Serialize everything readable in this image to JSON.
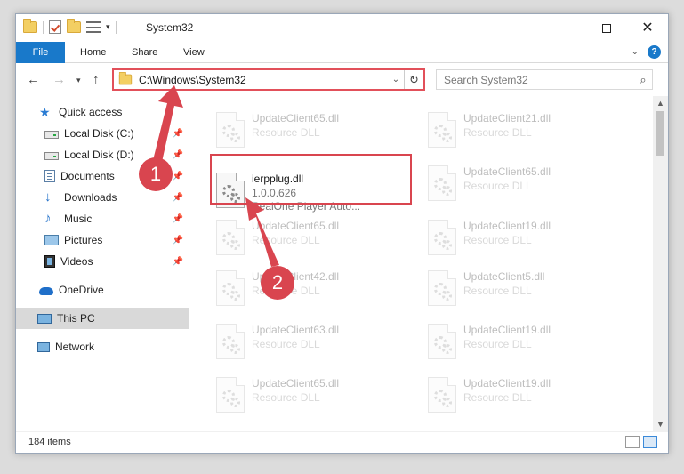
{
  "window": {
    "title": "System32",
    "controls": {
      "minimize": "minimize",
      "maximize": "maximize",
      "close": "✕"
    }
  },
  "ribbon": {
    "tabs": [
      {
        "label": "File"
      },
      {
        "label": "Home"
      },
      {
        "label": "Share"
      },
      {
        "label": "View"
      }
    ],
    "help": "?"
  },
  "address": {
    "path": "C:\\Windows\\System32",
    "refresh": "↻"
  },
  "search": {
    "placeholder": "Search System32",
    "icon": "search-icon"
  },
  "sidebar": {
    "items": [
      {
        "label": "Quick access",
        "icon": "star-icon"
      },
      {
        "label": "Local Disk (C:)",
        "icon": "disk-icon"
      },
      {
        "label": "Local Disk (D:)",
        "icon": "disk-icon"
      },
      {
        "label": "Documents",
        "icon": "documents-icon"
      },
      {
        "label": "Downloads",
        "icon": "downloads-icon"
      },
      {
        "label": "Music",
        "icon": "music-icon"
      },
      {
        "label": "Pictures",
        "icon": "pictures-icon"
      },
      {
        "label": "Videos",
        "icon": "videos-icon"
      },
      {
        "label": "OneDrive",
        "icon": "onedrive-icon"
      },
      {
        "label": "This PC",
        "icon": "this-pc-icon"
      },
      {
        "label": "Network",
        "icon": "network-icon"
      }
    ]
  },
  "files": {
    "left": [
      {
        "name": "UpdateClient65.dll",
        "type": "Resource DLL"
      },
      {
        "name": "ierpplug.dll",
        "version": "1.0.0.626",
        "description": "RealOne Player Auto..."
      },
      {
        "name": "UpdateClient65.dll",
        "type": "Resource DLL"
      },
      {
        "name": "UpdateClient42.dll",
        "type": "Resource DLL"
      },
      {
        "name": "UpdateClient63.dll",
        "type": "Resource DLL"
      },
      {
        "name": "UpdateClient65.dll",
        "type": "Resource DLL"
      }
    ],
    "right": [
      {
        "name": "UpdateClient21.dll",
        "type": "Resource DLL"
      },
      {
        "name": "UpdateClient65.dll",
        "type": "Resource DLL"
      },
      {
        "name": "UpdateClient19.dll",
        "type": "Resource DLL"
      },
      {
        "name": "UpdateClient5.dll",
        "type": "Resource DLL"
      },
      {
        "name": "UpdateClient19.dll",
        "type": "Resource DLL"
      },
      {
        "name": "UpdateClient19.dll",
        "type": "Resource DLL"
      }
    ]
  },
  "status": {
    "item_count": "184 items"
  },
  "annotations": {
    "step1": "1",
    "step2": "2",
    "color": "#d9454f"
  }
}
